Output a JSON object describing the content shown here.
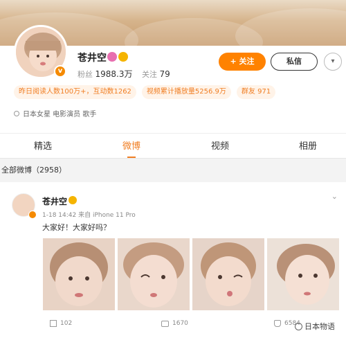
{
  "profile": {
    "name": "苍井空",
    "verified_badge": "v",
    "fans_label": "粉丝",
    "fans_value": "1988.3万",
    "following_label": "关注",
    "following_value": "79",
    "follow_button": "+ 关注",
    "message_button": "私信",
    "more_button": "▾",
    "tags": [
      "昨日阅读人数100万+，互动数1262",
      "视频累计播放量5256.9万",
      "群友 971"
    ],
    "description": "日本女星 电影演员 歌手"
  },
  "tabs": [
    {
      "label": "精选"
    },
    {
      "label": "微博"
    },
    {
      "label": "视频"
    },
    {
      "label": "相册"
    }
  ],
  "post_count": "全部微博（2958）",
  "post": {
    "author": "苍井空",
    "meta": "1-18 14:42 来自 iPhone 11 Pro",
    "text": "大家好！大家好吗？",
    "share_count": "102",
    "comment_count": "1670",
    "like_count": "6584"
  },
  "watermark": "日本物语",
  "colors": {
    "accent": "#ff8200",
    "tag_bg": "#fff3e8",
    "tag_text": "#f07e23"
  }
}
